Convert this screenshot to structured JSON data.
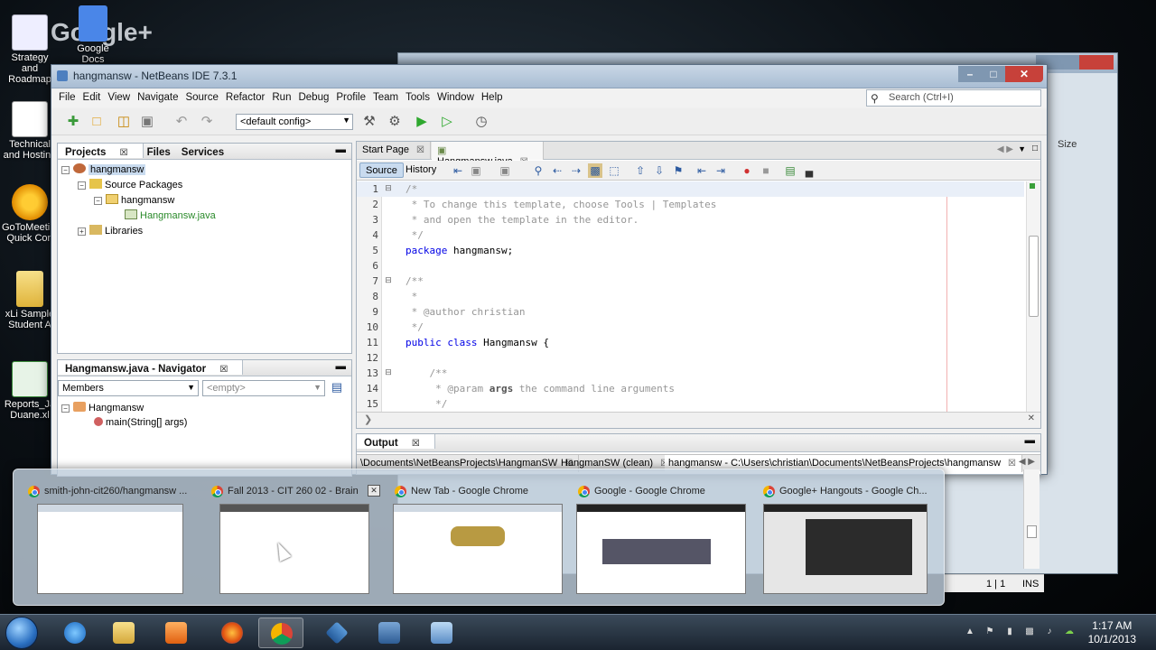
{
  "desktop": {
    "brand_text": "Google+",
    "icons": [
      {
        "label": "Strategy and Roadmap"
      },
      {
        "label": "Google Docs"
      },
      {
        "label": "Technical and Hosting"
      },
      {
        "label": "GoToMeeting Quick Con"
      },
      {
        "label": "xLi Sample Student A"
      },
      {
        "label": "Reports_Ja Duane.xl"
      }
    ]
  },
  "bg_window": {
    "size_label": "Size"
  },
  "netbeans": {
    "title": "hangmansw - NetBeans IDE 7.3.1",
    "menu": [
      "File",
      "Edit",
      "View",
      "Navigate",
      "Source",
      "Refactor",
      "Run",
      "Debug",
      "Profile",
      "Team",
      "Tools",
      "Window",
      "Help"
    ],
    "search_placeholder": "Search (Ctrl+I)",
    "config_value": "<default config>",
    "projects_panel": {
      "tabs": [
        "Projects",
        "Files",
        "Services"
      ],
      "tree": {
        "project": "hangmansw",
        "source_packages": "Source Packages",
        "package": "hangmansw",
        "file": "Hangmansw.java",
        "libraries": "Libraries"
      }
    },
    "navigator": {
      "title": "Hangmansw.java - Navigator",
      "members_select": "Members",
      "filter_select": "<empty>",
      "class_name": "Hangmansw",
      "method": "main(String[] args)"
    },
    "editor": {
      "tabs": [
        {
          "label": "Start Page"
        },
        {
          "label": "Hangmansw.java"
        }
      ],
      "source_btn": "Source",
      "history_btn": "History",
      "lines": [
        {
          "n": "1",
          "t": "/*"
        },
        {
          "n": "2",
          "t": " * To change this template, choose Tools | Templates"
        },
        {
          "n": "3",
          "t": " * and open the template in the editor."
        },
        {
          "n": "4",
          "t": " */"
        },
        {
          "n": "5",
          "kw": "package",
          "t": " hangmansw;"
        },
        {
          "n": "6",
          "t": ""
        },
        {
          "n": "7",
          "t": "/**"
        },
        {
          "n": "8",
          "t": " *"
        },
        {
          "n": "9",
          "t": " * @author christian"
        },
        {
          "n": "10",
          "t": " */"
        },
        {
          "n": "11",
          "kw": "public class",
          "t": " Hangmansw {"
        },
        {
          "n": "12",
          "t": ""
        },
        {
          "n": "13",
          "t": "    /**"
        },
        {
          "n": "14",
          "pre": "     * @param ",
          "bold": "args",
          "t": " the command line arguments"
        },
        {
          "n": "15",
          "t": "     */"
        }
      ]
    },
    "output": {
      "title": "Output",
      "tabs": [
        "\\Documents\\NetBeansProjects\\HangmanSW",
        "HangmanSW (clean)",
        "hangmansw - C:\\Users\\christian\\Documents\\NetBeansProjects\\hangmansw"
      ],
      "status_pos": "1 | 1",
      "status_mode": "INS"
    }
  },
  "peek": {
    "thumbs": [
      {
        "title": "smith-john-cit260/hangmansw ..."
      },
      {
        "title": "Fall 2013 - CIT 260 02 - Brain"
      },
      {
        "title": "New Tab - Google Chrome"
      },
      {
        "title": "Google - Google Chrome"
      },
      {
        "title": "Google+ Hangouts - Google Ch..."
      }
    ]
  },
  "taskbar": {
    "time": "1:17 AM",
    "date": "10/1/2013"
  }
}
